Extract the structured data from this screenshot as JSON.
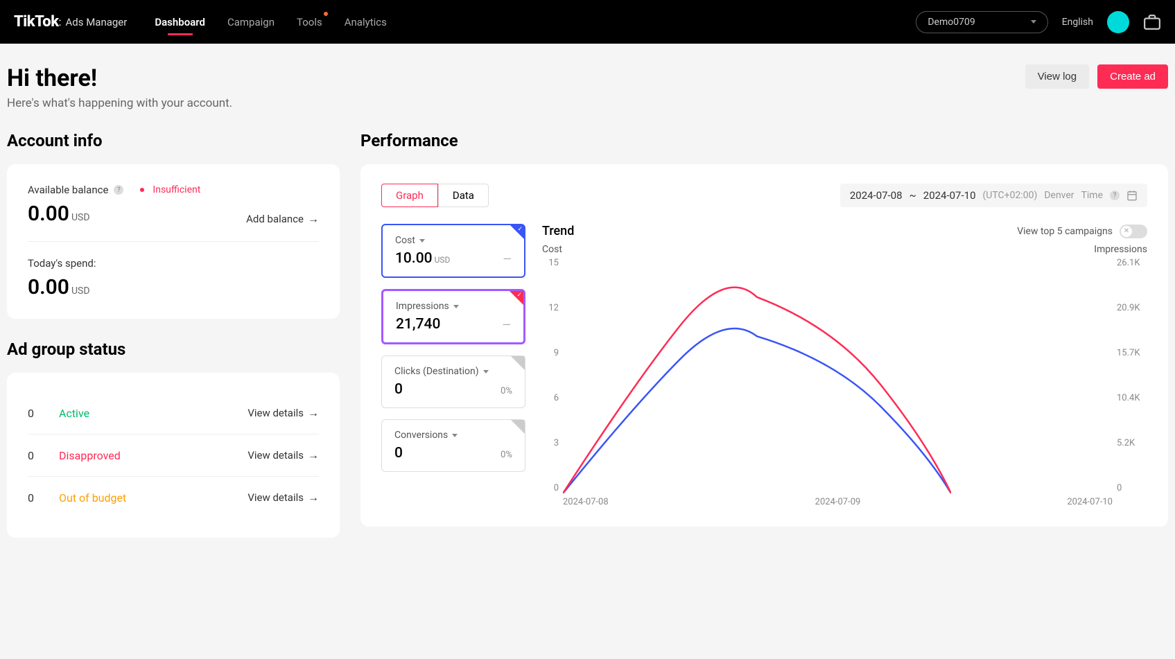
{
  "brand": {
    "name": "TikTok",
    "sub": "Ads Manager"
  },
  "nav": {
    "dashboard": "Dashboard",
    "campaign": "Campaign",
    "tools": "Tools",
    "analytics": "Analytics"
  },
  "header": {
    "account": "Demo0709",
    "language": "English"
  },
  "page": {
    "greeting_title": "Hi there!",
    "greeting_sub": "Here's what's happening with your account.",
    "view_log": "View log",
    "create_ad": "Create ad"
  },
  "account_info": {
    "title": "Account info",
    "available_label": "Available balance",
    "status": "Insufficient",
    "balance_value": "0.00",
    "balance_currency": "USD",
    "add_balance": "Add balance",
    "today_spend_label": "Today's spend:",
    "spend_value": "0.00",
    "spend_currency": "USD"
  },
  "ad_group": {
    "title": "Ad group status",
    "view_details": "View details",
    "rows": [
      {
        "count": "0",
        "label": "Active",
        "cls": "status-active"
      },
      {
        "count": "0",
        "label": "Disapproved",
        "cls": "status-disapproved"
      },
      {
        "count": "0",
        "label": "Out of budget",
        "cls": "status-outofbudget"
      }
    ]
  },
  "performance": {
    "title": "Performance",
    "tab_graph": "Graph",
    "tab_data": "Data",
    "date_from": "2024-07-08",
    "date_to": "2024-07-10",
    "tz": "(UTC+02:00)",
    "tz_name": "Denver",
    "tz_label": "Time",
    "metrics": {
      "cost": {
        "label": "Cost",
        "value": "10.00",
        "currency": "USD",
        "delta": "—"
      },
      "impressions": {
        "label": "Impressions",
        "value": "21,740",
        "delta": "—"
      },
      "clicks": {
        "label": "Clicks (Destination)",
        "value": "0",
        "delta": "0%"
      },
      "conversions": {
        "label": "Conversions",
        "value": "0",
        "delta": "0%"
      }
    },
    "trend": {
      "title": "Trend",
      "toggle_label": "View top 5 campaigns",
      "left_axis_label": "Cost",
      "right_axis_label": "Impressions"
    }
  },
  "chart_data": {
    "type": "line",
    "x": [
      "2024-07-08",
      "2024-07-09",
      "2024-07-10"
    ],
    "series": [
      {
        "name": "Cost",
        "axis": "left",
        "color": "#3955f6",
        "values": [
          0,
          10,
          0
        ]
      },
      {
        "name": "Impressions",
        "axis": "right",
        "color": "#fe2c55",
        "values": [
          0,
          21740,
          0
        ]
      }
    ],
    "ylim_left": [
      0,
      15
    ],
    "ylim_right": [
      0,
      26100
    ],
    "y_ticks_left": [
      "15",
      "12",
      "9",
      "6",
      "3",
      "0"
    ],
    "y_ticks_right": [
      "26.1K",
      "20.9K",
      "15.7K",
      "10.4K",
      "5.2K",
      "0"
    ]
  }
}
